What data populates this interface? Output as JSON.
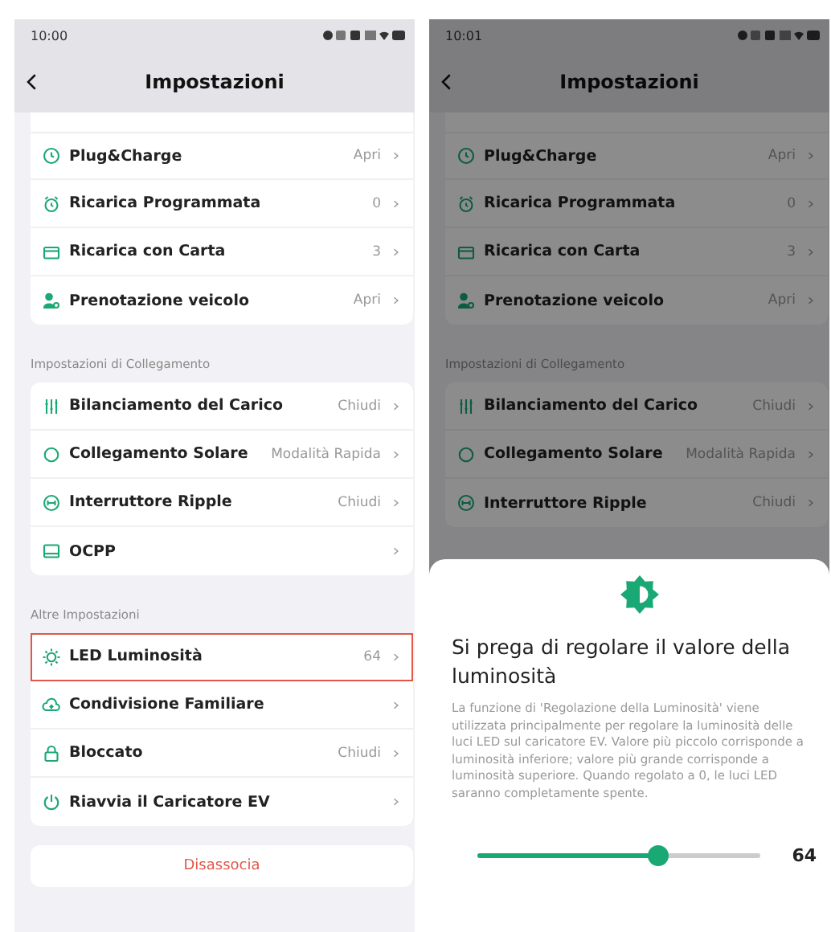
{
  "screens": [
    {
      "time": "10:00",
      "title": "Impostazioni",
      "dimmed": false,
      "sections": [
        {
          "items": [
            {
              "label": "Plug&Charge",
              "value": "Apri",
              "highlighted": false
            },
            {
              "label": "Ricarica Programmata",
              "value": "0",
              "highlighted": false
            },
            {
              "label": "Ricarica con Carta",
              "value": "3",
              "highlighted": false
            },
            {
              "label": "Prenotazione veicolo",
              "value": "Apri",
              "highlighted": false
            }
          ]
        },
        {
          "label": "Impostazioni di Collegamento",
          "items": [
            {
              "label": "Bilanciamento del Carico",
              "value": "Chiudi",
              "highlighted": false
            },
            {
              "label": "Collegamento Solare",
              "value": "Modalità Rapida",
              "highlighted": false
            },
            {
              "label": "Interruttore Ripple",
              "value": "Chiudi",
              "highlighted": false
            },
            {
              "label": "OCPP",
              "highlighted": false
            }
          ]
        },
        {
          "label": "Altre Impostazioni",
          "items": [
            {
              "label": "LED Luminosità",
              "value": "64",
              "highlighted": true
            },
            {
              "label": "Condivisione Familiare",
              "highlighted": false
            },
            {
              "label": "Bloccato",
              "value": "Chiudi",
              "highlighted": false
            },
            {
              "label": "Riavvia il Caricatore EV",
              "highlighted": false
            }
          ]
        }
      ],
      "action_button": "Disassocia"
    },
    {
      "time": "10:01",
      "title": "Impostazioni",
      "dimmed": true,
      "sections": [
        {
          "items": [
            {
              "label": "Plug&Charge",
              "value": "Apri",
              "highlighted": false
            },
            {
              "label": "Ricarica Programmata",
              "value": "0",
              "highlighted": false
            },
            {
              "label": "Ricarica con Carta",
              "value": "3",
              "highlighted": false
            },
            {
              "label": "Prenotazione veicolo",
              "value": "Apri",
              "highlighted": false
            }
          ]
        },
        {
          "label": "Impostazioni di Collegamento",
          "items": [
            {
              "label": "Bilanciamento del Carico",
              "value": "Chiudi",
              "highlighted": false
            },
            {
              "label": "Collegamento Solare",
              "value": "Modalità Rapida",
              "highlighted": false
            },
            {
              "label": "Interruttore Ripple",
              "value": "Chiudi",
              "highlighted": false
            }
          ]
        }
      ],
      "sheet": {
        "title": "Si prega di regolare il valore della luminosità",
        "description": "La funzione di 'Regolazione della Luminosità' viene utilizzata principalmente per regolare la luminosità delle luci LED sul caricatore EV. Valore più piccolo corrisponde a luminosità inferiore; valore più grande corrisponde a luminosità superiore. Quando regolato a 0, le luci LED saranno completamente spente.",
        "slider": {
          "level": 0.64,
          "reading": "64"
        }
      }
    }
  ]
}
